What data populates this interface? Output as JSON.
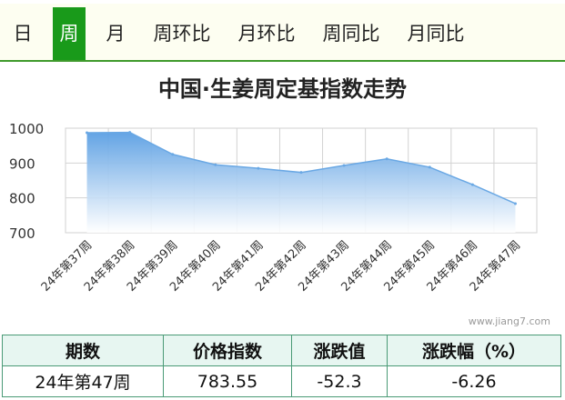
{
  "tabs": [
    {
      "label": "日",
      "active": false
    },
    {
      "label": "周",
      "active": true
    },
    {
      "label": "月",
      "active": false
    },
    {
      "label": "周环比",
      "active": false
    },
    {
      "label": "月环比",
      "active": false
    },
    {
      "label": "周同比",
      "active": false
    },
    {
      "label": "月同比",
      "active": false
    }
  ],
  "watermark": "www.jiang7.com",
  "colors": {
    "active_tab": "#199a1a",
    "tab_bar_border": "#3f9a2c",
    "line": "#6aa8e4",
    "table_border": "#4a9a76"
  },
  "chart_data": {
    "type": "area",
    "title": "中国·生姜周定基指数走势",
    "xlabel": "",
    "ylabel": "",
    "categories": [
      "24年第37周",
      "24年第38周",
      "24年第39周",
      "24年第40周",
      "24年第41周",
      "24年第42周",
      "24年第43周",
      "24年第44周",
      "24年第45周",
      "24年第46周",
      "24年第47周"
    ],
    "series": [
      {
        "values": [
          987,
          988,
          925,
          895,
          885,
          873,
          893,
          912,
          888,
          838,
          783.55
        ]
      }
    ],
    "ylim": [
      700,
      1000
    ],
    "yticks": [
      "700",
      "800",
      "900",
      "1000"
    ],
    "grid": true
  },
  "summary_table": {
    "headers": [
      "期数",
      "价格指数",
      "涨跌值",
      "涨跌幅（%）"
    ],
    "rows": [
      [
        "24年第47周",
        "783.55",
        "-52.3",
        "-6.26"
      ]
    ]
  }
}
